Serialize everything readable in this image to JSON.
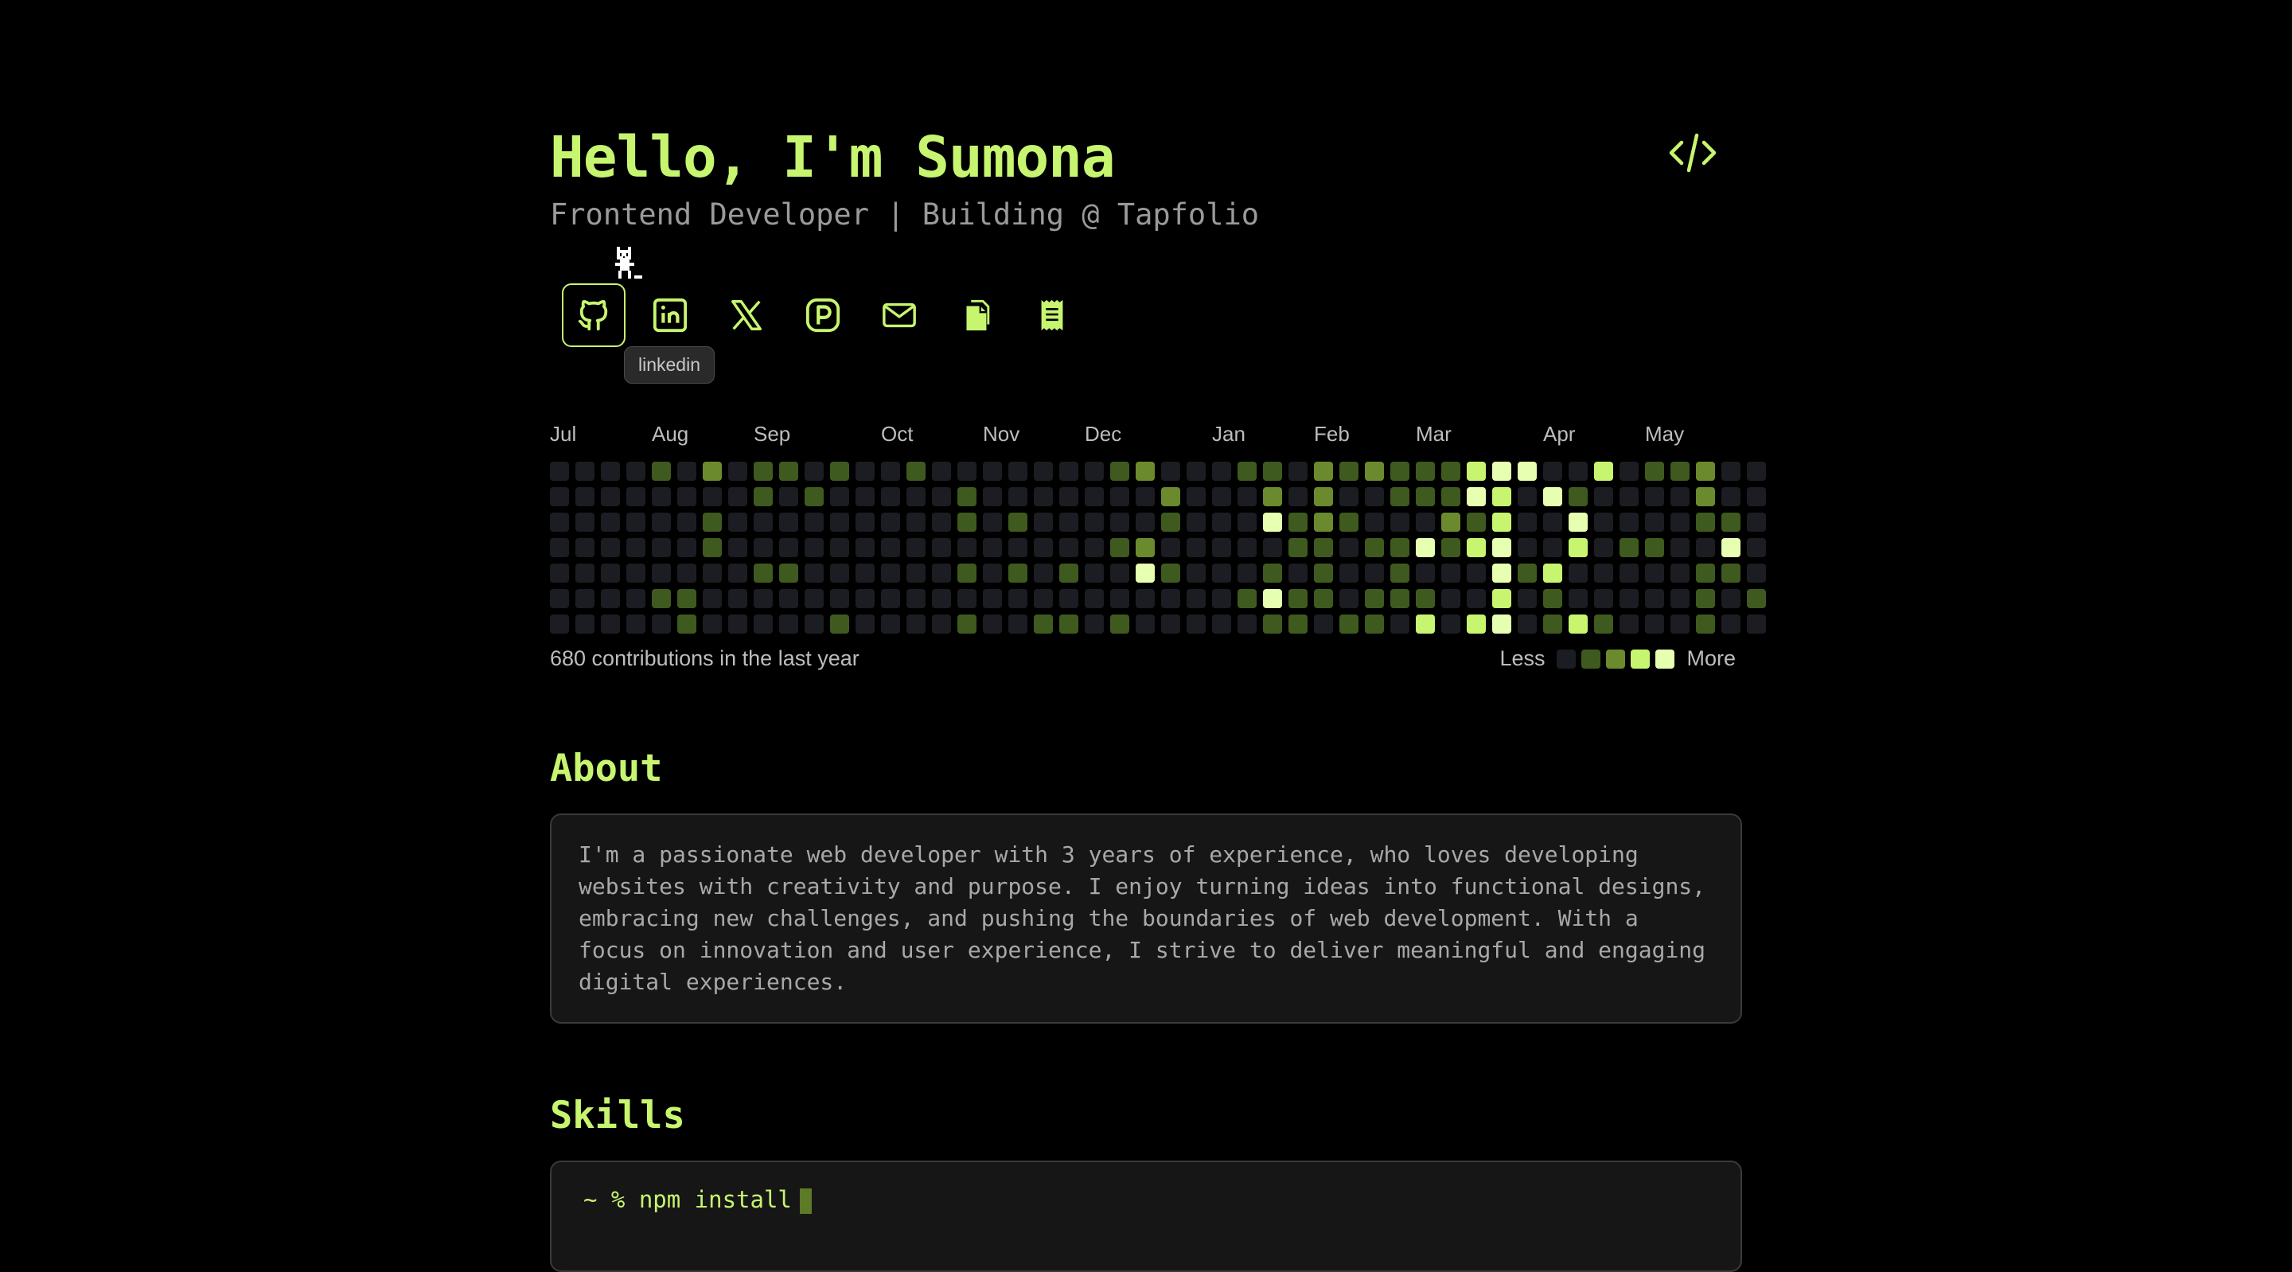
{
  "hero": {
    "title": "Hello, I'm Sumona",
    "subtitle": "Frontend Developer | Building @ Tapfolio"
  },
  "header": {
    "code_icon": "code-icon"
  },
  "social": {
    "items": [
      {
        "name": "github",
        "icon": "github-icon"
      },
      {
        "name": "linkedin",
        "icon": "linkedin-icon"
      },
      {
        "name": "x",
        "icon": "x-icon"
      },
      {
        "name": "peerlist",
        "icon": "peerlist-icon"
      },
      {
        "name": "email",
        "icon": "mail-icon"
      },
      {
        "name": "copy",
        "icon": "copy-icon"
      },
      {
        "name": "resume",
        "icon": "receipt-icon"
      }
    ],
    "tooltip": "linkedin"
  },
  "contributions": {
    "months": [
      "Jul",
      "Aug",
      "Sep",
      "Oct",
      "Nov",
      "Dec",
      "Jan",
      "Feb",
      "Mar",
      "Apr",
      "May"
    ],
    "total_label": "680 contributions in the last year",
    "legend_less": "Less",
    "legend_more": "More",
    "level_colors": [
      "#1b1d22",
      "#3f5a1e",
      "#6b8a2e",
      "#c7f56f",
      "#e6ffb0"
    ],
    "levels": [
      [
        0,
        0,
        0,
        0,
        1,
        0,
        2,
        0,
        1,
        1,
        0,
        1,
        0,
        0,
        1,
        0,
        0,
        0,
        0,
        0,
        0,
        0,
        1,
        2,
        0,
        0,
        0,
        1,
        1,
        0,
        2,
        1,
        2,
        1,
        1,
        1,
        3,
        4,
        4,
        0,
        0,
        3,
        0,
        1,
        1,
        2,
        0,
        0
      ],
      [
        0,
        0,
        0,
        0,
        0,
        0,
        0,
        0,
        1,
        0,
        1,
        0,
        0,
        0,
        0,
        0,
        1,
        0,
        0,
        0,
        0,
        0,
        0,
        0,
        2,
        0,
        0,
        0,
        2,
        0,
        2,
        0,
        0,
        1,
        1,
        1,
        4,
        3,
        0,
        4,
        1,
        0,
        0,
        0,
        0,
        2,
        0,
        0
      ],
      [
        0,
        0,
        0,
        0,
        0,
        0,
        1,
        0,
        0,
        0,
        0,
        0,
        0,
        0,
        0,
        0,
        1,
        0,
        1,
        0,
        0,
        0,
        0,
        0,
        1,
        0,
        0,
        0,
        4,
        1,
        2,
        1,
        0,
        0,
        0,
        2,
        1,
        3,
        0,
        0,
        4,
        0,
        0,
        0,
        0,
        1,
        1,
        0
      ],
      [
        0,
        0,
        0,
        0,
        0,
        0,
        1,
        0,
        0,
        0,
        0,
        0,
        0,
        0,
        0,
        0,
        0,
        0,
        0,
        0,
        0,
        0,
        1,
        2,
        0,
        0,
        0,
        0,
        0,
        1,
        1,
        0,
        1,
        1,
        4,
        1,
        3,
        4,
        0,
        0,
        3,
        0,
        1,
        1,
        0,
        0,
        4,
        0
      ],
      [
        0,
        0,
        0,
        0,
        0,
        0,
        0,
        0,
        1,
        1,
        0,
        0,
        0,
        0,
        0,
        0,
        1,
        0,
        1,
        0,
        1,
        0,
        0,
        4,
        1,
        0,
        0,
        0,
        1,
        0,
        1,
        0,
        0,
        1,
        0,
        0,
        0,
        4,
        1,
        3,
        0,
        0,
        0,
        0,
        0,
        1,
        1,
        0
      ],
      [
        0,
        0,
        0,
        0,
        1,
        1,
        0,
        0,
        0,
        0,
        0,
        0,
        0,
        0,
        0,
        0,
        0,
        0,
        0,
        0,
        0,
        0,
        0,
        0,
        0,
        0,
        0,
        1,
        4,
        1,
        1,
        0,
        1,
        1,
        1,
        0,
        0,
        3,
        0,
        1,
        0,
        0,
        0,
        0,
        0,
        1,
        0,
        1
      ],
      [
        0,
        0,
        0,
        0,
        0,
        1,
        0,
        0,
        0,
        0,
        0,
        1,
        0,
        0,
        0,
        0,
        1,
        0,
        0,
        1,
        1,
        0,
        1,
        0,
        0,
        0,
        0,
        0,
        1,
        1,
        0,
        1,
        1,
        0,
        3,
        0,
        3,
        4,
        0,
        1,
        3,
        1,
        0,
        0,
        0,
        1,
        0,
        0
      ]
    ]
  },
  "about": {
    "heading": "About",
    "text": "I'm a passionate web developer with 3 years of experience, who loves developing websites with creativity and purpose. I enjoy turning ideas into functional designs, embracing new challenges, and pushing the boundaries of web development. With a focus on innovation and user experience, I strive to deliver meaningful and engaging digital experiences."
  },
  "skills": {
    "heading": "Skills",
    "prompt": "~ % npm install"
  }
}
